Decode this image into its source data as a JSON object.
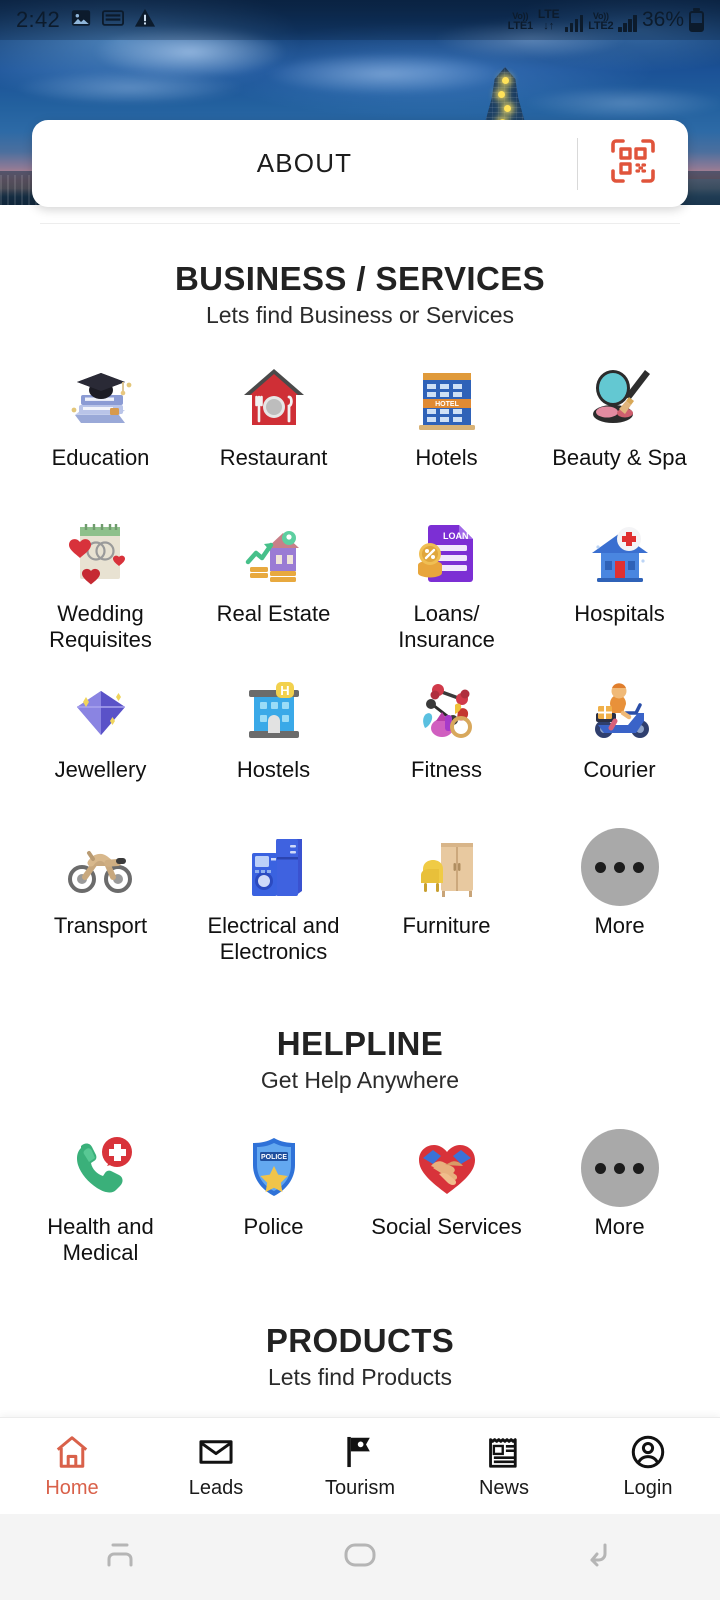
{
  "status_bar": {
    "time": "2:42",
    "left_icons": [
      "image-icon",
      "sim-card-icon",
      "warning-icon"
    ],
    "sim1_volte": "Vo))",
    "sim1_label": "LTE1",
    "lte_top": "LTE",
    "lte_arrows": "↓↑",
    "sim2_volte": "Vo))",
    "sim2_label": "LTE2",
    "battery_percent": "36%"
  },
  "header": {
    "card_label": "ABOUT",
    "qr_icon": "qr-scan-icon",
    "qr_color": "#e0543b"
  },
  "sections": [
    {
      "id": "business",
      "title": "BUSINESS / SERVICES",
      "subtitle": "Lets find Business or Services",
      "items": [
        {
          "label": "Education",
          "icon": "graduation-books-icon"
        },
        {
          "label": "Restaurant",
          "icon": "restaurant-house-icon"
        },
        {
          "label": "Hotels",
          "icon": "hotel-building-icon"
        },
        {
          "label": "Beauty & Spa",
          "icon": "makeup-brush-icon"
        },
        {
          "label": "Wedding Requisites",
          "icon": "wedding-rings-notepad-icon"
        },
        {
          "label": "Real Estate",
          "icon": "house-growth-chart-icon"
        },
        {
          "label": "Loans/ Insurance",
          "icon": "loan-document-icon"
        },
        {
          "label": "Hospitals",
          "icon": "hospital-building-icon"
        },
        {
          "label": "Jewellery",
          "icon": "gem-diamond-icon"
        },
        {
          "label": "Hostels",
          "icon": "hostel-building-icon"
        },
        {
          "label": "Fitness",
          "icon": "gym-equipment-icon"
        },
        {
          "label": "Courier",
          "icon": "delivery-scooter-icon"
        },
        {
          "label": "Transport",
          "icon": "motorbike-icon"
        },
        {
          "label": "Electrical and Electronics",
          "icon": "fridge-washer-icon"
        },
        {
          "label": "Furniture",
          "icon": "wardrobe-chair-icon"
        },
        {
          "label": "More",
          "icon": "more-dots-icon"
        }
      ]
    },
    {
      "id": "helpline",
      "title": "HELPLINE",
      "subtitle": "Get Help Anywhere",
      "items": [
        {
          "label": "Health and Medical",
          "icon": "emergency-call-icon"
        },
        {
          "label": "Police",
          "icon": "police-badge-icon"
        },
        {
          "label": "Social Services",
          "icon": "handshake-heart-icon"
        },
        {
          "label": "More",
          "icon": "more-dots-icon"
        }
      ]
    },
    {
      "id": "products",
      "title": "PRODUCTS",
      "subtitle": "Lets find Products",
      "items": []
    }
  ],
  "tabbar": {
    "active": "Home",
    "active_color": "#d9614a",
    "items": [
      {
        "label": "Home",
        "icon": "home-icon"
      },
      {
        "label": "Leads",
        "icon": "envelope-icon"
      },
      {
        "label": "Tourism",
        "icon": "flag-icon"
      },
      {
        "label": "News",
        "icon": "newspaper-icon"
      },
      {
        "label": "Login",
        "icon": "account-circle-icon"
      }
    ]
  },
  "system_nav": {
    "recents": "recents-icon",
    "home": "home-pill-icon",
    "back": "back-arrow-icon"
  }
}
